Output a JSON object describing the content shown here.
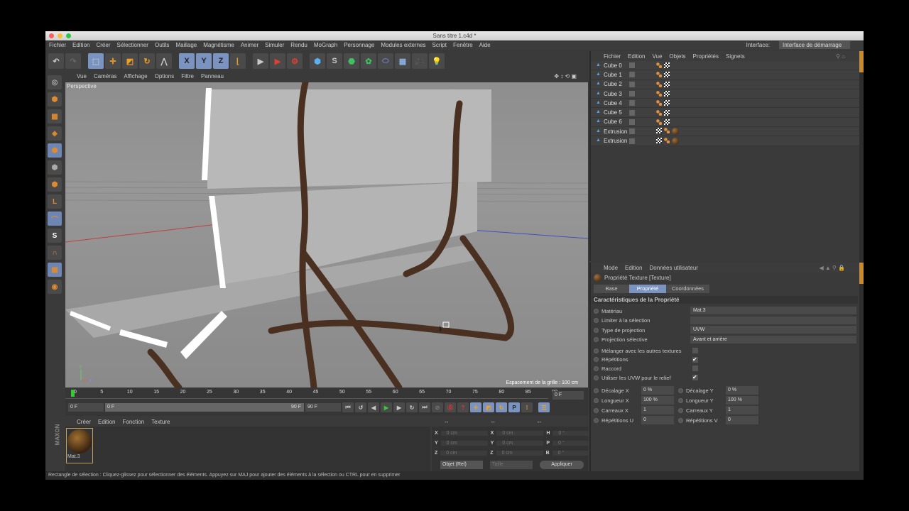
{
  "window": {
    "title": "Sans titre 1.c4d *"
  },
  "menu": [
    "Fichier",
    "Edition",
    "Créer",
    "Sélectionner",
    "Outils",
    "Maillage",
    "Magnétisme",
    "Animer",
    "Simuler",
    "Rendu",
    "MoGraph",
    "Personnage",
    "Modules externes",
    "Script",
    "Fenêtre",
    "Aide"
  ],
  "interface": {
    "label": "Interface:",
    "value": "Interface de démarrage"
  },
  "toolbar": {
    "x": "X",
    "y": "Y",
    "z": "Z"
  },
  "viewport": {
    "menu": [
      "Vue",
      "Caméras",
      "Affichage",
      "Options",
      "Filtre",
      "Panneau"
    ],
    "label": "Perspective",
    "grid": "Espacement de la grille : 100 cm"
  },
  "timeline": {
    "ticks": [
      "0",
      "5",
      "10",
      "15",
      "20",
      "25",
      "30",
      "35",
      "40",
      "45",
      "50",
      "55",
      "60",
      "65",
      "70",
      "75",
      "80",
      "85",
      "90"
    ],
    "current": "0 F",
    "start": "0 F",
    "range_start": "0 F",
    "range_end": "90 F",
    "end": "90 F"
  },
  "materials": {
    "menu": [
      "Créer",
      "Edition",
      "Fonction",
      "Texture"
    ],
    "items": [
      {
        "name": "Mat.3"
      }
    ]
  },
  "coords": {
    "headers": [
      "--",
      "--",
      "--"
    ],
    "rows": [
      [
        "X",
        "0 cm",
        "X",
        "0 cm",
        "H",
        "0 °"
      ],
      [
        "Y",
        "0 cm",
        "Y",
        "0 cm",
        "P",
        "0 °"
      ],
      [
        "Z",
        "0 cm",
        "Z",
        "0 cm",
        "B",
        "0 °"
      ]
    ],
    "mode": "Objet (Rel)",
    "size": "Taille",
    "apply": "Appliquer"
  },
  "status": "Rectangle de sélection : Cliquez-glissez pour sélectionner des éléments. Appuyez sur MAJ pour ajouter des éléments à la sélection ou CTRL pour en supprimer",
  "objects": {
    "menu": [
      "Fichier",
      "Edition",
      "Vue",
      "Objets",
      "Propriétés",
      "Signets"
    ],
    "items": [
      {
        "name": "Cube 0"
      },
      {
        "name": "Cube 1"
      },
      {
        "name": "Cube 2"
      },
      {
        "name": "Cube 3"
      },
      {
        "name": "Cube 4"
      },
      {
        "name": "Cube 5"
      },
      {
        "name": "Cube 6"
      },
      {
        "name": "Extrusion"
      },
      {
        "name": "Extrusion"
      }
    ]
  },
  "attributes": {
    "menu": [
      "Mode",
      "Edition",
      "Données utilisateur"
    ],
    "title": "Propriété Texture [Texture]",
    "tabs": [
      "Base",
      "Propriété",
      "Coordonnées"
    ],
    "section": "Caractéristiques de la Propriété",
    "fields": [
      {
        "label": "Matériau",
        "value": "Mat.3"
      },
      {
        "label": "Limiter à la sélection",
        "value": ""
      },
      {
        "label": "Type de projection",
        "value": "UVW"
      },
      {
        "label": "Projection sélective",
        "value": "Avant et arrière"
      }
    ],
    "checks": [
      {
        "label": "Mélanger avec les autres textures",
        "checked": false
      },
      {
        "label": "Répétitions",
        "checked": true
      },
      {
        "label": "Raccord",
        "checked": false
      },
      {
        "label": "Utiliser les UVW pour le relief",
        "checked": true
      }
    ],
    "pairs": [
      [
        "Décalage X",
        "0 %",
        "Décalage Y",
        "0 %"
      ],
      [
        "Longueur X",
        "100 %",
        "Longueur Y",
        "100 %"
      ],
      [
        "Carreaux X",
        "1",
        "Carreaux Y",
        "1"
      ],
      [
        "Répétitions U",
        "0",
        "Répétitions V",
        "0"
      ]
    ],
    "check_mark": "✔"
  }
}
